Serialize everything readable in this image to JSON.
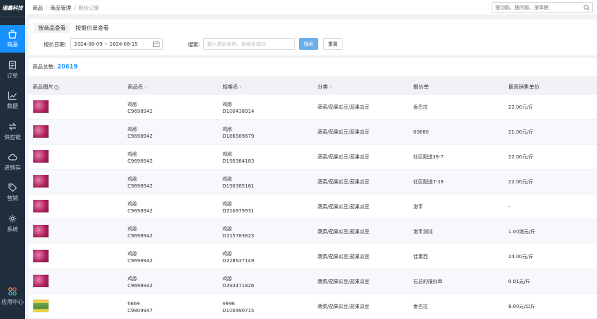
{
  "app": {
    "logo_text": "瑞鑫科技"
  },
  "sidebar": {
    "items": [
      {
        "label": "商品",
        "icon": "bag-icon",
        "active": true
      },
      {
        "label": "订单",
        "icon": "document-icon",
        "active": false
      },
      {
        "label": "数据",
        "icon": "line-chart-icon",
        "active": false
      },
      {
        "label": "供应链",
        "icon": "exchange-icon",
        "active": false
      },
      {
        "label": "进销存",
        "icon": "cloud-icon",
        "active": false
      },
      {
        "label": "营销",
        "icon": "tag-icon",
        "active": false
      },
      {
        "label": "系统",
        "icon": "gear-icon",
        "active": false
      },
      {
        "label": "应用中心",
        "icon": "apps-icon",
        "active": false
      }
    ]
  },
  "breadcrumb": {
    "items": [
      "商品",
      "商品管理",
      "报价记录"
    ]
  },
  "global_search": {
    "placeholder": "搜功能、搜问题、搜单据"
  },
  "tabs": [
    {
      "label": "按商品查看",
      "active": true
    },
    {
      "label": "按报价单查看",
      "active": false
    }
  ],
  "filters": {
    "date_label": "报价日期:",
    "date_range": "2024-08-09 ~ 2024-08-15",
    "keyword_label": "搜索:",
    "keyword_placeholder": "输入商品名称、规格名或ID",
    "search_button": "搜索",
    "reset_button": "重置"
  },
  "summary": {
    "label": "商品总数:",
    "total": "20619"
  },
  "table": {
    "columns": [
      "商品图片",
      "商品名",
      "规格名",
      "分类",
      "报价单",
      "最高销售单价"
    ],
    "rows": [
      {
        "thumb": "pink",
        "product_name": "鸡胗",
        "product_id": "C9698942",
        "spec_name": "鸡胗",
        "spec_id": "D100438914",
        "category": "蔬菜/茄果瓜豆/茄果瓜豆",
        "quote": "香巴拉",
        "price": "22.00元/斤"
      },
      {
        "thumb": "pink",
        "product_name": "鸡胗",
        "product_id": "C9698942",
        "spec_name": "鸡胗",
        "spec_id": "D186589679",
        "category": "蔬菜/茄果瓜豆/茄果瓜豆",
        "quote": "00666",
        "price": "21.00元/斤"
      },
      {
        "thumb": "pink",
        "product_name": "鸡胗",
        "product_id": "C9698942",
        "spec_name": "鸡胗",
        "spec_id": "D190384183",
        "category": "蔬菜/茄果瓜豆/茄果瓜豆",
        "quote": "社区配送19-7",
        "price": "22.00元/斤"
      },
      {
        "thumb": "pink",
        "product_name": "鸡胗",
        "product_id": "C9698942",
        "spec_name": "鸡胗",
        "spec_id": "D190385161",
        "category": "蔬菜/茄果瓜豆/茄果瓜豆",
        "quote": "社区配送7-19",
        "price": "22.00元/斤"
      },
      {
        "thumb": "pink",
        "product_name": "鸡胗",
        "product_id": "C9698942",
        "spec_name": "鸡胗",
        "spec_id": "D210879931",
        "category": "蔬菜/茄果瓜豆/茄果瓜豆",
        "quote": "港币",
        "price": "-"
      },
      {
        "thumb": "pink",
        "product_name": "鸡胗",
        "product_id": "C9698942",
        "spec_name": "鸡胗",
        "spec_id": "D215783623",
        "category": "蔬菜/茄果瓜豆/茄果瓜豆",
        "quote": "港币测试",
        "price": "1.00港元/斤"
      },
      {
        "thumb": "pink",
        "product_name": "鸡胗",
        "product_id": "C9698942",
        "spec_name": "鸡胗",
        "spec_id": "D228637149",
        "category": "蔬菜/茄果瓜豆/茄果瓜豆",
        "quote": "佳莱西",
        "price": "24.00元/斤"
      },
      {
        "thumb": "pink",
        "product_name": "鸡胗",
        "product_id": "C9698942",
        "spec_name": "鸡胗",
        "spec_id": "D293471826",
        "category": "蔬菜/茄果瓜豆/茄果瓜豆",
        "quote": "石总的报价单",
        "price": "0.01元/斤"
      },
      {
        "thumb": "green",
        "product_name": "6669",
        "product_id": "C9809947",
        "spec_name": "9996",
        "spec_id": "D100990715",
        "category": "蔬菜/茄果瓜豆/茄果瓜豆",
        "quote": "香巴拉",
        "price": "8.00元/公斤"
      }
    ]
  },
  "colors": {
    "sidebar_bg": "#1f2d3d",
    "accent": "#1890ff",
    "primary_button": "#6aafe9"
  }
}
